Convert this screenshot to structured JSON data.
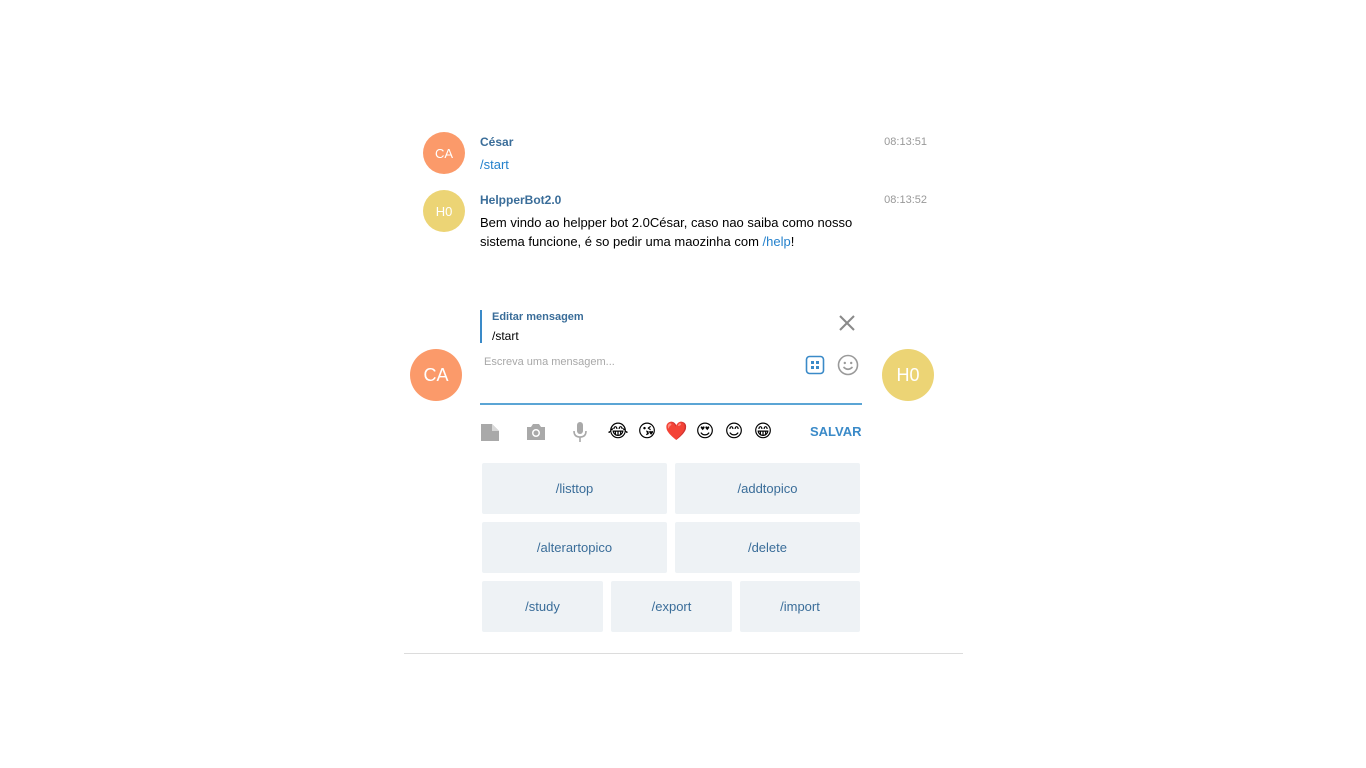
{
  "messages": [
    {
      "author": "César",
      "avatar_initials": "CA",
      "avatar_color": "#fb9a6a",
      "time": "08:13:51",
      "text_parts": [
        "/start"
      ]
    },
    {
      "author": "HelpperBot2.0",
      "avatar_initials": "H0",
      "avatar_color": "#ecd475",
      "time": "08:13:52",
      "text_before_link": "Bem vindo ao helpper bot 2.0César, caso nao saiba como nosso sistema funcione, é so pedir uma maozinha com ",
      "link": "/help",
      "text_after_link": "!"
    }
  ],
  "edit": {
    "title": "Editar mensagem",
    "text": "/start"
  },
  "composer": {
    "placeholder": "Escreva uma mensagem...",
    "user_avatar": "CA",
    "peer_avatar": "H0",
    "save_label": "SALVAR"
  },
  "emojis": [
    "😂",
    "😘",
    "❤️",
    "😍",
    "😊",
    "😁"
  ],
  "keyboard": {
    "row1": [
      "/listtop",
      "/addtopico"
    ],
    "row2": [
      "/alterartopico",
      "/delete"
    ],
    "row3": [
      "/study",
      "/export",
      "/import"
    ]
  },
  "colors": {
    "accent": "#3a8ac8",
    "author": "#3a6d99",
    "user_avatar": "#fb9a6a",
    "bot_avatar": "#ecd475",
    "keyboard_bg": "#eef2f5"
  }
}
